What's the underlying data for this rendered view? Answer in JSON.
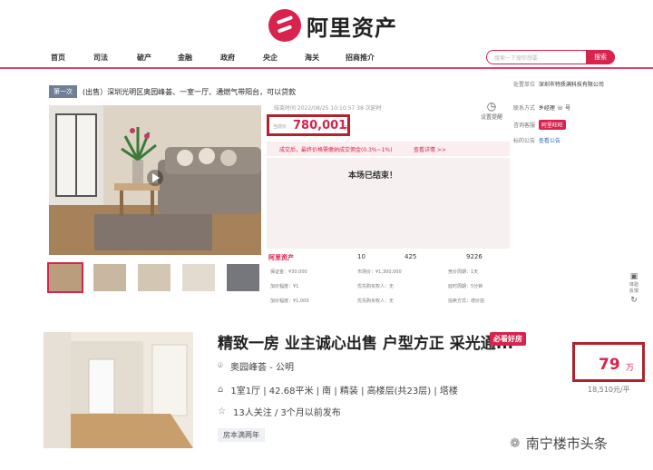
{
  "brand": {
    "name": "阿里资产"
  },
  "nav": {
    "items": [
      "首页",
      "司法",
      "破产",
      "金融",
      "政府",
      "央企",
      "海关",
      "招商推介"
    ],
    "search_placeholder": "搜索一下搜你想要",
    "search_button": "搜索"
  },
  "auction": {
    "round_badge": "第一次",
    "title": "(出售）深圳光明区奥园峰荟、一室一厅、通燃气带阳台，可以贷款",
    "time_text": "结束时间  2022/08/25 10:10:57 38 次延时",
    "price_label": "当前价",
    "price_value": "780,001",
    "price_unit": "元",
    "notice_text": "成交后，最终价格需缴纳成交佣金(0.3%~1%)",
    "notice_link": "查看详情 >>",
    "ended_text": "本场已结束！",
    "stats_brand": "阿里资产",
    "stats": [
      "10",
      "425",
      "9226"
    ],
    "grid": [
      "保证金：¥30,000",
      "市场价：¥1,300,000",
      "竞价周期：1天",
      "加价幅度：¥1",
      "优先购买权人：无",
      "延时周期：5分钟",
      "加价幅度：¥1,000",
      "优先购买权人：无",
      "拍卖方式：增价拍"
    ],
    "side_label": "设置提醒"
  },
  "seller": {
    "rows": [
      {
        "label": "处置单位",
        "value": "深圳市特质满科技有限公司"
      },
      {
        "label": "联系方式",
        "value": "乡经理  ☏ 号"
      },
      {
        "label": "咨询客服",
        "value": "阿里旺旺"
      },
      {
        "label": "标的公告",
        "value": "查看公告"
      }
    ]
  },
  "float_tools": [
    "体验",
    "反馈"
  ],
  "listing": {
    "title": "精致一房 业主诚心出售 户型方正 采光通...",
    "tag": "必看好房",
    "location": "奥园峰荟 - 公明",
    "details": "1室1厅 | 42.68平米 | 南 | 精装 | 高楼层(共23层) | 塔楼",
    "followers": "13人关注 / 3个月以前发布",
    "badge": "房本满两年",
    "price": "79",
    "price_unit": "万",
    "unit_price": "18,510元/平"
  },
  "watermark": "南宁楼市头条",
  "colors": {
    "accent": "#d7234d",
    "highlight_box": "#b0232c"
  }
}
